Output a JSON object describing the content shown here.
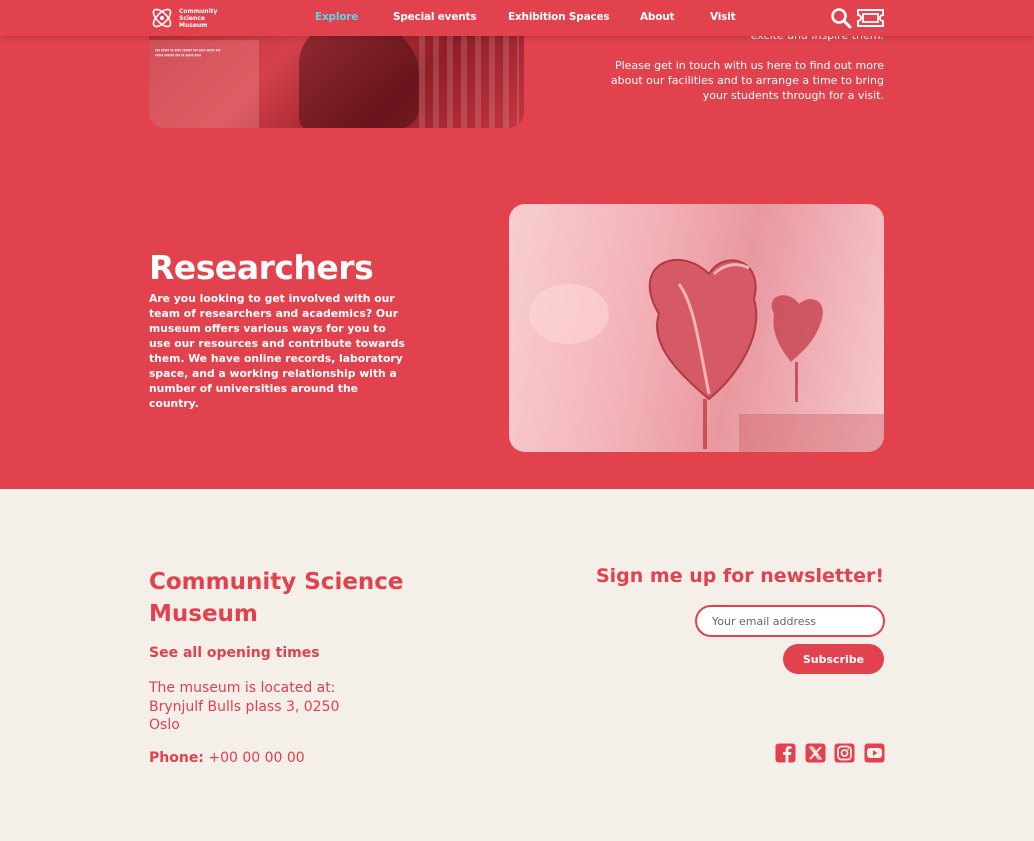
{
  "colors": {
    "brand_red": "#e2424d",
    "active_nav": "#5bd6e8",
    "footer_bg": "#f5efe9"
  },
  "logo": {
    "lines": [
      "Community",
      "Science",
      "Museum"
    ],
    "icon": "atom-icon"
  },
  "nav": [
    {
      "label": "Explore",
      "active": true
    },
    {
      "label": "Special events",
      "active": false
    },
    {
      "label": "Exhibition Spaces",
      "active": false
    },
    {
      "label": "About",
      "active": false
    },
    {
      "label": "Visit",
      "active": false
    }
  ],
  "header_icons": [
    "search-icon",
    "ticket-icon"
  ],
  "intro": {
    "line_partial": "excite and inspire them.",
    "contact": "Please get in touch with us here to find out more about our facilities and to arrange a time to bring your students through for a visit."
  },
  "researchers": {
    "title": "Researchers",
    "body": "Are you looking to get involved with our team of researchers and academics? Our museum offers various ways for you to use our resources and contribute towards them. We have online records, laboratory space, and a working relationship with a number of universities around the country."
  },
  "footer": {
    "title": "Community Science Museum",
    "hours_link": "See all opening times",
    "address_lines": [
      "The museum is located at:",
      "Brynjulf Bulls plass 3, 0250",
      "Oslo"
    ],
    "phone_label": "Phone:",
    "phone_value": "+00 00 00 00",
    "newsletter": {
      "title": "Sign me up for newsletter!",
      "placeholder": "Your email address",
      "button": "Subscribe"
    },
    "social": [
      "facebook-icon",
      "x-icon",
      "instagram-icon",
      "youtube-icon"
    ]
  }
}
